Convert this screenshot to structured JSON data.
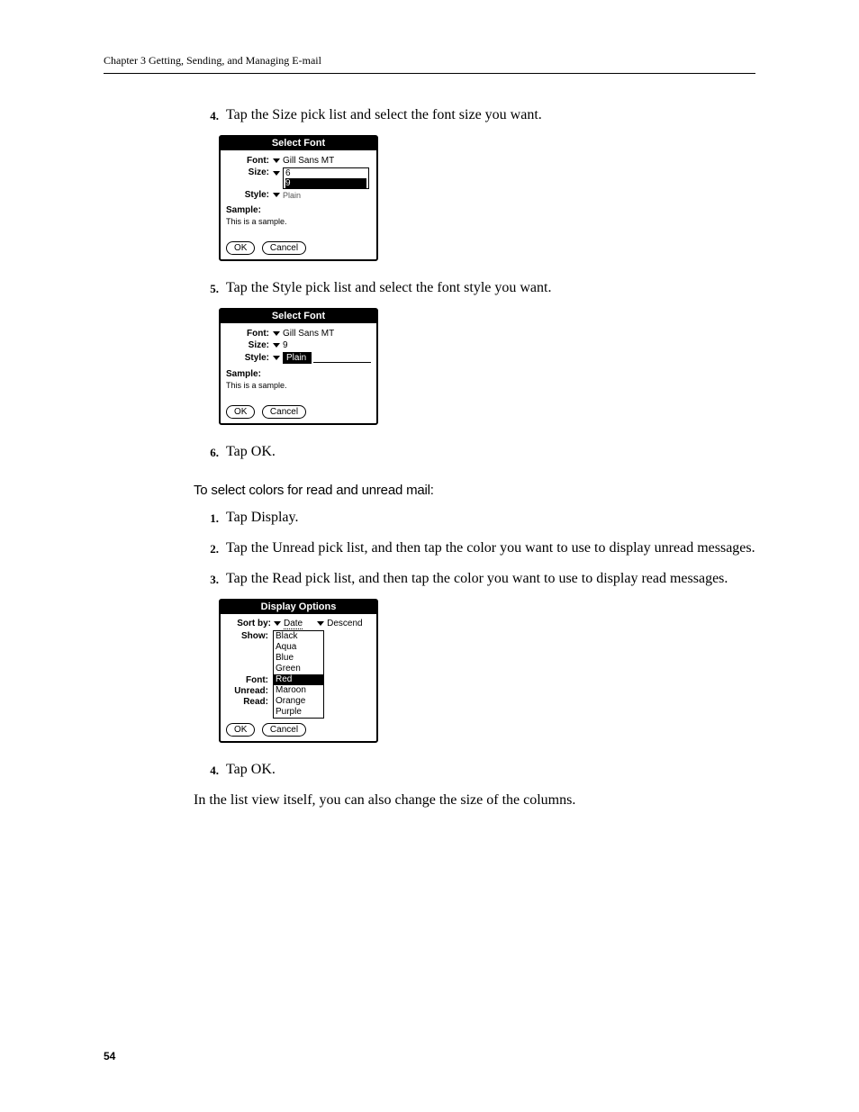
{
  "header": "Chapter 3   Getting, Sending, and Managing E-mail",
  "page_number": "54",
  "steps_a": {
    "4": {
      "num": "4.",
      "text": "Tap the Size pick list and select the font size you want."
    },
    "5": {
      "num": "5.",
      "text": "Tap the Style pick list and select the font style you want."
    },
    "6": {
      "num": "6.",
      "text": "Tap OK."
    }
  },
  "section_heading": "To select colors for read and unread mail:",
  "steps_b": {
    "1": {
      "num": "1.",
      "text": "Tap Display."
    },
    "2": {
      "num": "2.",
      "text": "Tap the Unread pick list, and then tap the color you want to use to display unread messages."
    },
    "3": {
      "num": "3.",
      "text": "Tap the Read pick list, and then tap the color you want to use to display read messages."
    },
    "4": {
      "num": "4.",
      "text": "Tap OK."
    }
  },
  "after_text": "In the list view itself, you can also change the size of the columns.",
  "dialog1": {
    "title": "Select Font",
    "font_label": "Font:",
    "font_value": "Gill Sans MT",
    "size_label": "Size:",
    "size_vals": [
      "6",
      "9"
    ],
    "style_label": "Style:",
    "style_value": "Plain",
    "sample_label": "Sample:",
    "sample_text": "This is a sample.",
    "ok": "OK",
    "cancel": "Cancel"
  },
  "dialog2": {
    "title": "Select Font",
    "font_label": "Font:",
    "font_value": "Gill Sans MT",
    "size_label": "Size:",
    "size_value": "9",
    "style_label": "Style:",
    "style_value": "Plain",
    "sample_label": "Sample:",
    "sample_text": "This is a sample.",
    "ok": "OK",
    "cancel": "Cancel"
  },
  "dialog3": {
    "title": "Display Options",
    "sort_label": "Sort by:",
    "sort_value": "Date",
    "order_value": "Descend",
    "show_label": "Show:",
    "font_label": "Font:",
    "unread_label": "Unread:",
    "read_label": "Read:",
    "colors": [
      "Black",
      "Aqua",
      "Blue",
      "Green",
      "Red",
      "Maroon",
      "Orange",
      "Purple"
    ],
    "ok": "OK",
    "cancel": "Cancel"
  }
}
